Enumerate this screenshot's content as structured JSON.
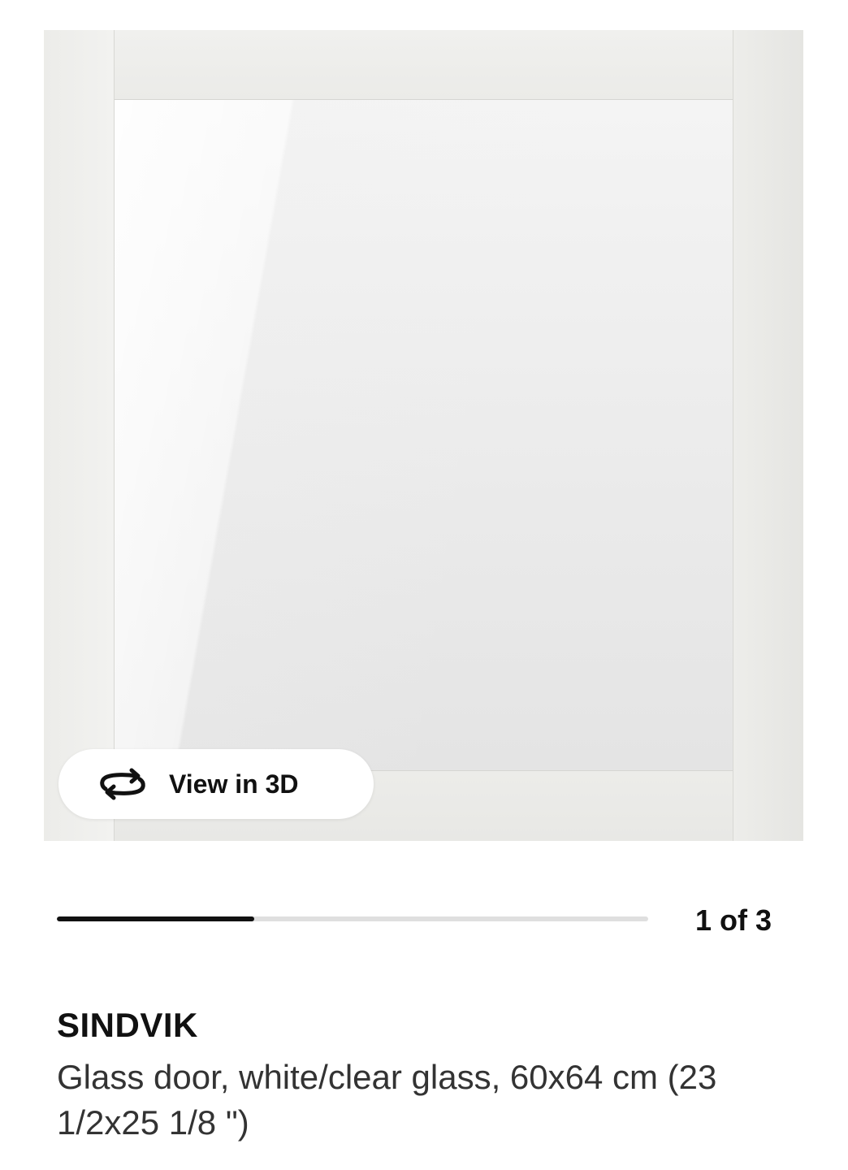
{
  "product": {
    "name": "SINDVIK",
    "description": "Glass door, white/clear glass, 60x64 cm (23 1/2x25 1/8 \")"
  },
  "gallery": {
    "view_3d_label": "View in 3D",
    "view_3d_icon": "rotate-3d-icon",
    "current_slide": 1,
    "total_slides": 3,
    "counter_text": "1 of 3",
    "progress_fraction": 0.3333
  },
  "colors": {
    "progress_fill": "#111111",
    "progress_track": "#dfdfdf"
  }
}
